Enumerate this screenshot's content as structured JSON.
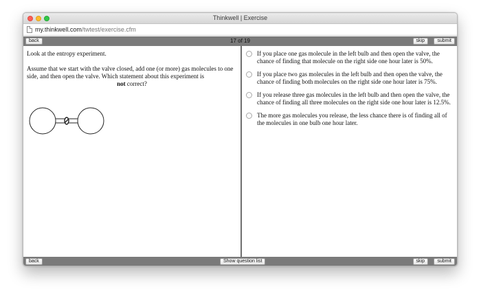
{
  "window": {
    "title": "Thinkwell | Exercise"
  },
  "address_bar": {
    "domain": "my.thinkwell.com",
    "path": "/twtest/exercise.cfm"
  },
  "toolbar_top": {
    "back_label": "back",
    "progress": "17 of 19",
    "skip_label": "skip",
    "submit_label": "submit"
  },
  "question": {
    "intro": "Look at the entropy experiment.",
    "prompt": "Assume that we start with the valve closed, add one (or more) gas molecules to one side, and then open the valve. Which statement about this experiment is",
    "emphasis": "not",
    "prompt_end": "correct?"
  },
  "options": [
    {
      "text": "If you place one gas molecule in the left bulb and then open the valve, the chance of finding that molecule on the right side one hour later is 50%."
    },
    {
      "text": "If you place two gas molecules in the left bulb and then open the valve, the chance of finding both molecules on the right side one hour later is 75%."
    },
    {
      "text": "If you release three gas molecules in the left bulb and then open the valve, the chance of finding all three molecules on the right side one hour later is 12.5%."
    },
    {
      "text": "The more gas molecules you release, the less chance there is of finding all of the molecules in one bulb one hour later."
    }
  ],
  "toolbar_bottom": {
    "back_label": "back",
    "question_list_label": "Show question list",
    "skip_label": "skip",
    "submit_label": "submit"
  },
  "colors": {
    "toolbar": "#7a7a7a",
    "divider": "#6e6e6e",
    "close": "#fc5f57",
    "minimize": "#fdbc2e",
    "maximize": "#34c84a"
  },
  "icons": {
    "page": "document-icon",
    "radio": "radio-icon"
  }
}
